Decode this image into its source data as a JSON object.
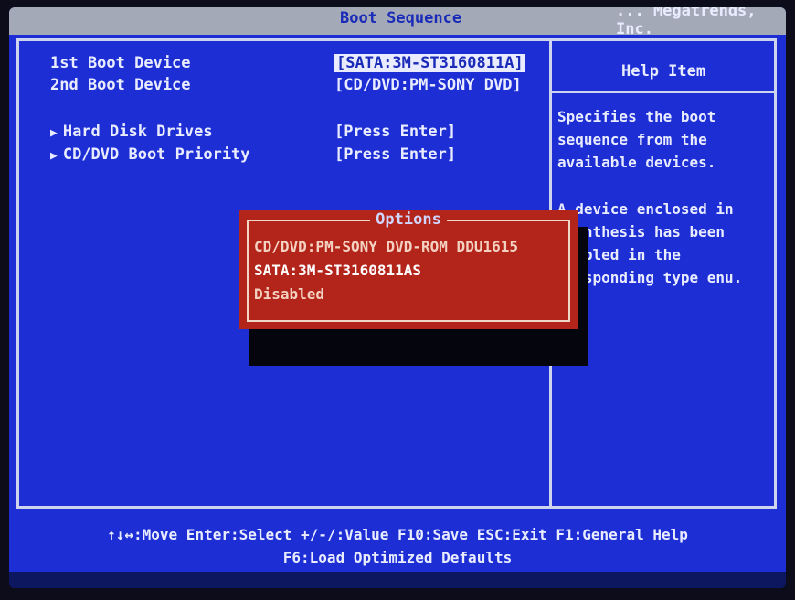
{
  "header": {
    "title": "Boot Sequence",
    "brand": "... Megatrends, Inc."
  },
  "settings": [
    {
      "label": "1st Boot Device",
      "value": "[SATA:3M-ST3160811A]",
      "selected": true
    },
    {
      "label": "2nd Boot Device",
      "value": "[CD/DVD:PM-SONY DVD]",
      "selected": false
    },
    {
      "label": "Hard Disk Drives",
      "value": "[Press Enter]",
      "submenu": true
    },
    {
      "label": "CD/DVD Boot Priority",
      "value": "[Press Enter]",
      "submenu": true
    }
  ],
  "help": {
    "heading": "Help Item",
    "para1": "Specifies the boot sequence from the available devices.",
    "para2": "A device enclosed in arenthesis has been isabled in the rresponding type enu."
  },
  "popup": {
    "title": "Options",
    "options": [
      "CD/DVD:PM-SONY DVD-ROM DDU1615",
      "SATA:3M-ST3160811AS",
      "Disabled"
    ],
    "active_index": 1
  },
  "footer": {
    "line1": "↑↓↔:Move  Enter:Select  +/-/:Value  F10:Save  ESC:Exit  F1:General Help",
    "line2": "F6:Load Optimized Defaults"
  },
  "colors": {
    "background": "#1d2fd4",
    "popup": "#b3241a",
    "text": "#e9ecff"
  }
}
